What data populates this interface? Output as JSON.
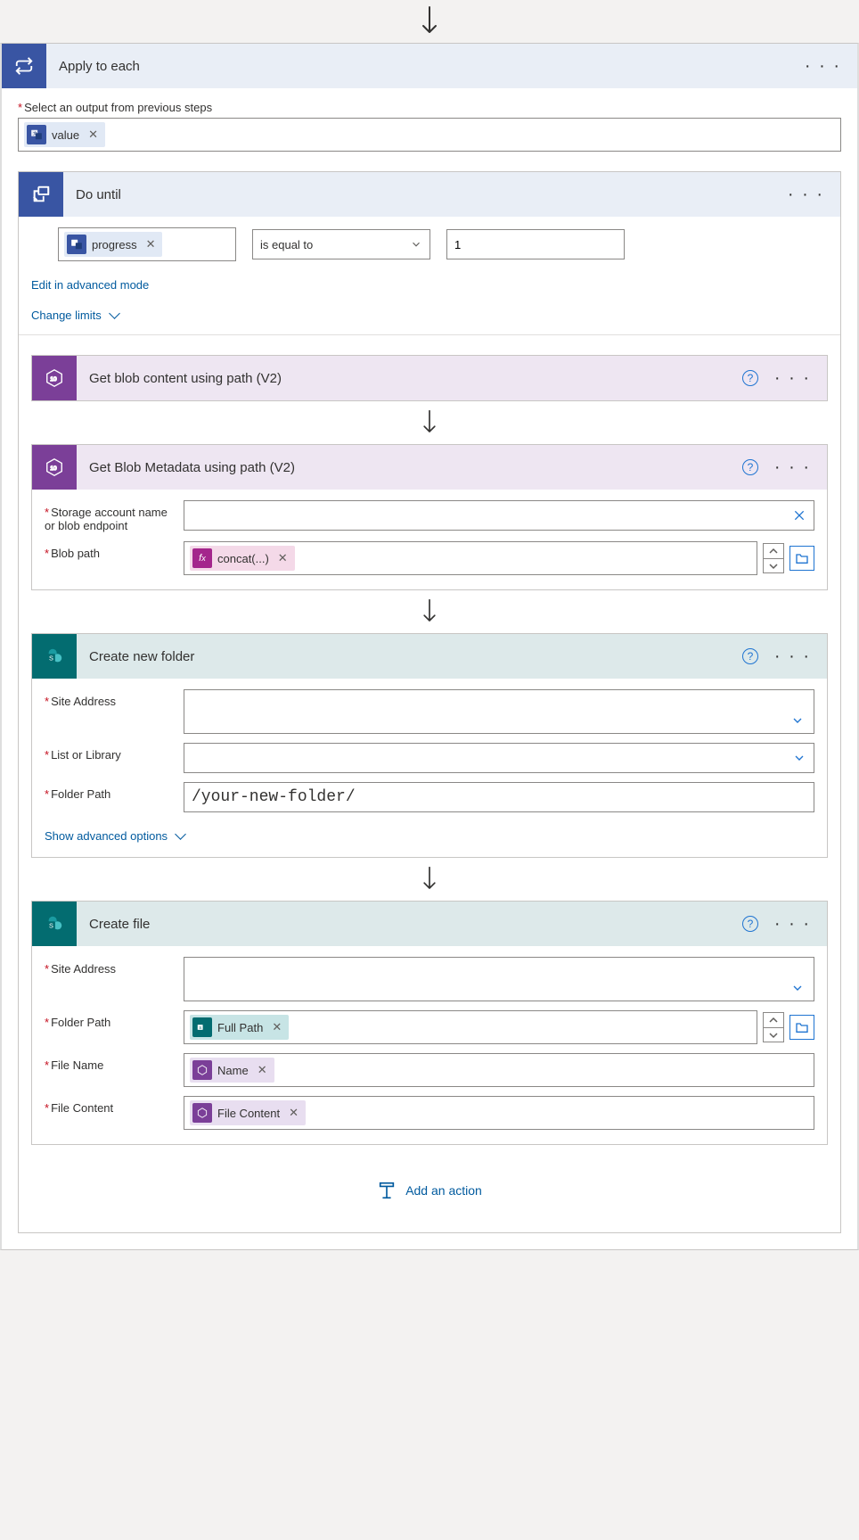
{
  "applyToEach": {
    "title": "Apply to each",
    "selectOutputLabel": "Select an output from previous steps",
    "token": "value"
  },
  "doUntil": {
    "title": "Do until",
    "leftToken": "progress",
    "operator": "is equal to",
    "rightValue": "1",
    "editAdvanced": "Edit in advanced mode",
    "changeLimits": "Change limits"
  },
  "getBlobContent": {
    "title": "Get blob content using path (V2)"
  },
  "getBlobMetadata": {
    "title": "Get Blob Metadata using path (V2)",
    "fields": {
      "storageLabel": "Storage account name or blob endpoint",
      "blobPathLabel": "Blob path",
      "blobPathToken": "concat(...)"
    }
  },
  "createFolder": {
    "title": "Create new folder",
    "siteAddressLabel": "Site Address",
    "listLibraryLabel": "List or Library",
    "folderPathLabel": "Folder Path",
    "folderPathValue": "/your-new-folder/",
    "showAdvanced": "Show advanced options"
  },
  "createFile": {
    "title": "Create file",
    "siteAddressLabel": "Site Address",
    "folderPathLabel": "Folder Path",
    "folderPathToken": "Full Path",
    "fileNameLabel": "File Name",
    "fileNameToken": "Name",
    "fileContentLabel": "File Content",
    "fileContentToken": "File Content"
  },
  "addAction": "Add an action"
}
